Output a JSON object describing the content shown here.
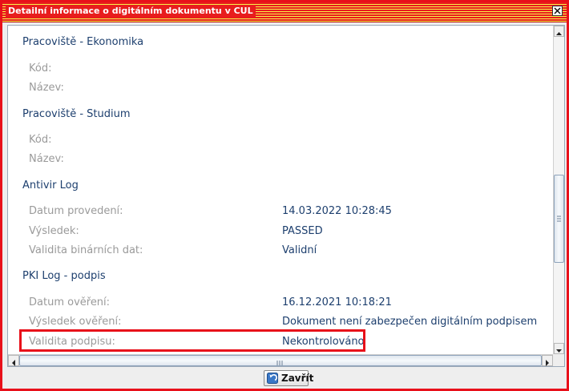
{
  "window": {
    "title": "Detailní informace o digitálním dokumentu v CUL"
  },
  "sections": [
    {
      "title": "Pracoviště - Ekonomika",
      "rows": [
        {
          "label": "Kód:",
          "value": ""
        },
        {
          "label": "Název:",
          "value": ""
        }
      ]
    },
    {
      "title": "Pracoviště - Studium",
      "rows": [
        {
          "label": "Kód:",
          "value": ""
        },
        {
          "label": "Název:",
          "value": ""
        }
      ]
    },
    {
      "title": "Antivir Log",
      "rows": [
        {
          "label": "Datum provedení:",
          "value": "14.03.2022 10:28:45"
        },
        {
          "label": "Výsledek:",
          "value": "PASSED"
        },
        {
          "label": "Validita binárních dat:",
          "value": "Validní"
        }
      ]
    },
    {
      "title": "PKI Log - podpis",
      "rows": [
        {
          "label": "Datum ověření:",
          "value": "16.12.2021 10:18:21"
        },
        {
          "label": "Výsledek ověření:",
          "value": "Dokument není zabezpečen digitálním podpisem"
        },
        {
          "label": "Validita podpisu:",
          "value": "Nekontrolováno"
        }
      ]
    }
  ],
  "footer": {
    "close_label": "Zavřít"
  },
  "icons": {
    "close": "close-icon",
    "back": "back-arrow-icon"
  },
  "colors": {
    "accent": "#e8101a",
    "section_text": "#1d3f6e",
    "label_text": "#9a9a9a"
  }
}
